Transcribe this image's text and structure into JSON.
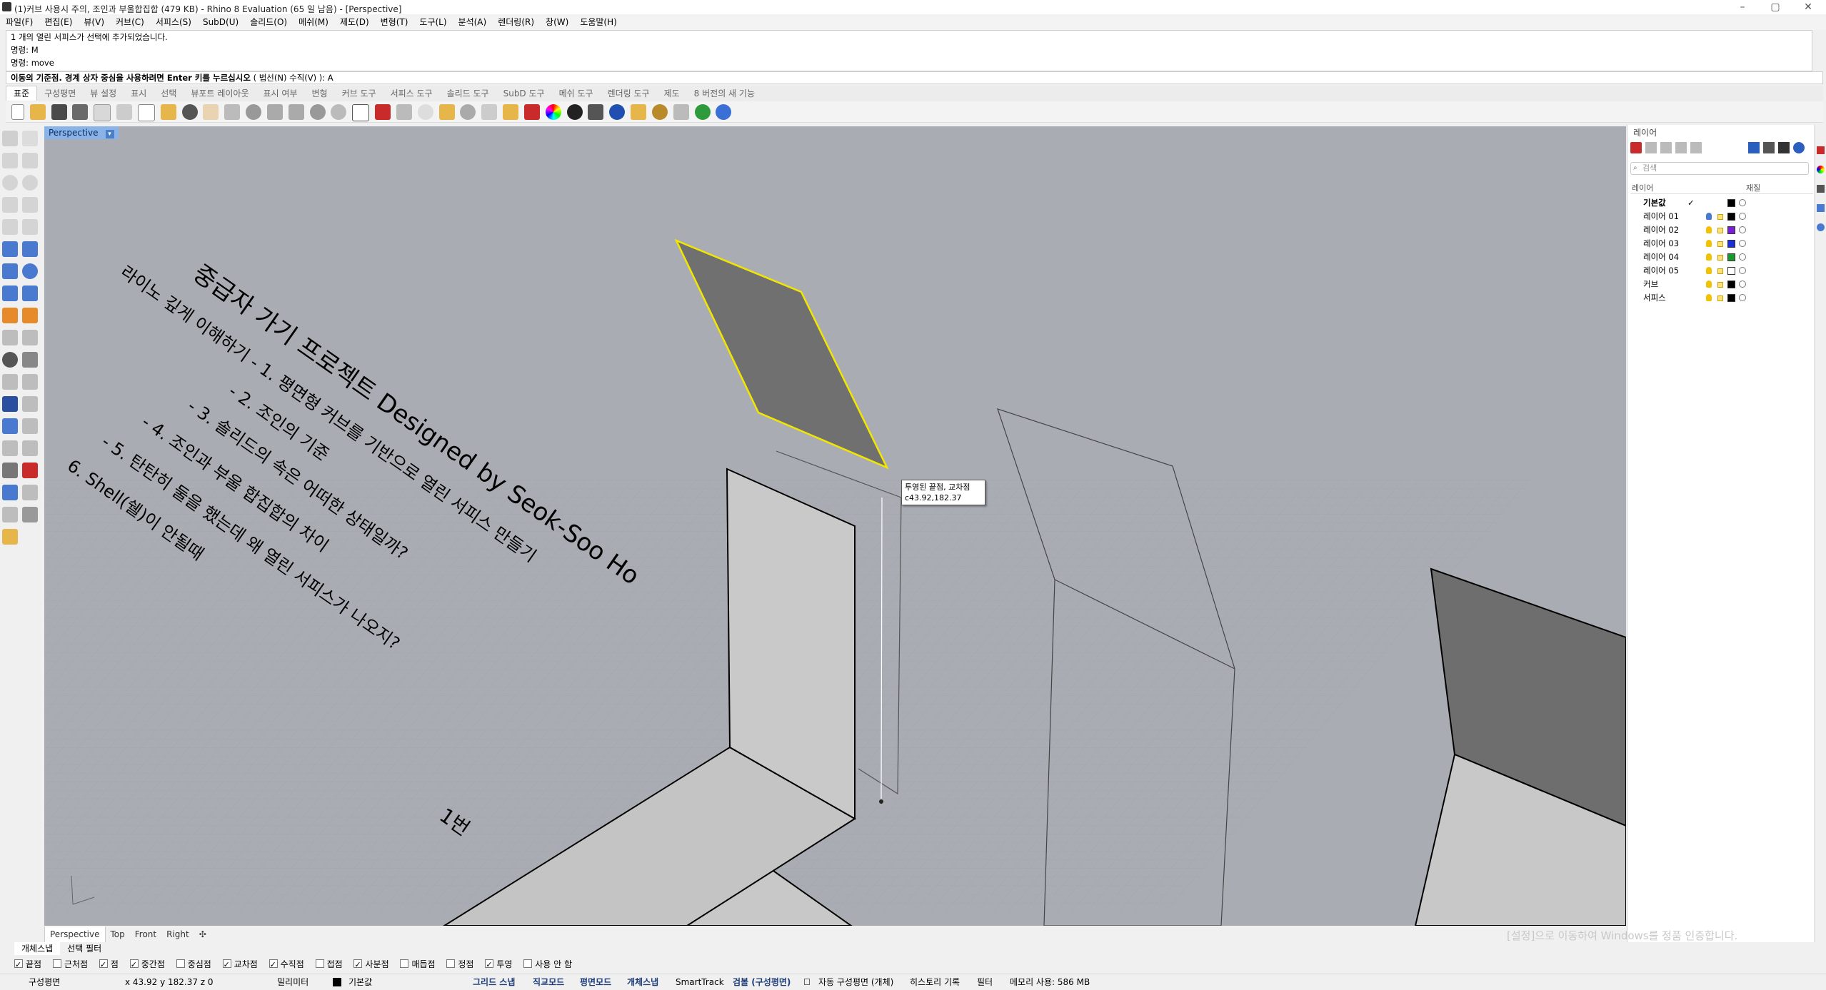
{
  "window": {
    "title": "(1)커브 사용시 주의, 조인과 부울합집합 (479 KB) - Rhino 8 Evaluation (65 일 남음) - [Perspective]"
  },
  "menu": [
    "파일(F)",
    "편집(E)",
    "뷰(V)",
    "커브(C)",
    "서피스(S)",
    "SubD(U)",
    "솔리드(O)",
    "메쉬(M)",
    "제도(D)",
    "변형(T)",
    "도구(L)",
    "분석(A)",
    "렌더링(R)",
    "창(W)",
    "도움말(H)"
  ],
  "command": {
    "history": [
      "1 개의 열린 서피스가 선택에 추가되었습니다.",
      "명령: M",
      "명령: move"
    ],
    "prompt": "이동의 기준점. 경계 상자 중심을 사용하려면 Enter 키를 누르십시오",
    "options": "( 법선(N)  수직(V) ): A"
  },
  "toolbar_tabs": [
    "표준",
    "구성평면",
    "뷰 설정",
    "표시",
    "선택",
    "뷰포트 레이아웃",
    "표시 여부",
    "변형",
    "커브 도구",
    "서피스 도구",
    "솔리드 도구",
    "SubD 도구",
    "메쉬 도구",
    "렌더링 도구",
    "제도",
    "8 버전의 새 기능"
  ],
  "viewport": {
    "label": "Perspective",
    "tabs": [
      "Perspective",
      "Top",
      "Front",
      "Right"
    ],
    "text_lines": [
      "중급자 가기 프로젝트 Designed by Seok-Soo Ho",
      "라이노 깊게 이해하기 - 1. 평면형 커브를 기반으로 열린 서피스 만들기",
      "- 2. 조인의 기준",
      "- 3. 솔리드의 속은 어떠한 상태일까?",
      "- 4. 조인과 부울 합집합의 차이",
      "- 5. 탄탄히 둘을 했는데 왜 열린 서피스가 나오지?",
      "6. Shell(쉘)이 안될때"
    ],
    "label_1": "1번",
    "tooltip_line1": "투영된 끝점, 교차점",
    "tooltip_line2": "c43.92,182.37"
  },
  "layers_panel": {
    "title": "레이어",
    "search_placeholder": "검색",
    "header_layer": "레이어",
    "header_material": "재질",
    "layers": [
      {
        "name": "기본값",
        "color": "#000000",
        "current": "✓"
      },
      {
        "name": "레이어 01",
        "color": "#000000",
        "current": ""
      },
      {
        "name": "레이어 02",
        "color": "#7a1fd6",
        "current": ""
      },
      {
        "name": "레이어 03",
        "color": "#1a2fd6",
        "current": ""
      },
      {
        "name": "레이어 04",
        "color": "#1a9a2a",
        "current": ""
      },
      {
        "name": "레이어 05",
        "color": "#ffffff",
        "current": ""
      },
      {
        "name": "커브",
        "color": "#000000",
        "current": ""
      },
      {
        "name": "서피스",
        "color": "#000000",
        "current": ""
      }
    ]
  },
  "osnap_tabs": [
    "개체스냅",
    "선택 필터"
  ],
  "osnaps": [
    {
      "label": "끝점",
      "on": true
    },
    {
      "label": "근처점",
      "on": false
    },
    {
      "label": "점",
      "on": true
    },
    {
      "label": "중간점",
      "on": true
    },
    {
      "label": "중심점",
      "on": false
    },
    {
      "label": "교차점",
      "on": true
    },
    {
      "label": "수직점",
      "on": true
    },
    {
      "label": "접점",
      "on": false
    },
    {
      "label": "사분점",
      "on": true
    },
    {
      "label": "매듭점",
      "on": false
    },
    {
      "label": "정점",
      "on": false
    },
    {
      "label": "투영",
      "on": true
    },
    {
      "label": "사용 안 함",
      "on": false
    }
  ],
  "status": {
    "cplane": "구성평면",
    "coords": "x 43.92   y 182.37   z 0",
    "units": "밀리미터",
    "layer": "기본값",
    "grid_snap": "그리드 스냅",
    "ortho": "직교모드",
    "planar": "평면모드",
    "osnap": "개체스냅",
    "smarttrack": "SmartTrack",
    "gumball": "검볼 (구성평면)",
    "auto_cplane": "자동 구성평면 (개체)",
    "history": "히스토리 기록",
    "filter": "필터",
    "memory": "메모리 사용: 586 MB"
  },
  "watermark": "[설정]으로 이동하여 Windows를 정품 인증합니다."
}
